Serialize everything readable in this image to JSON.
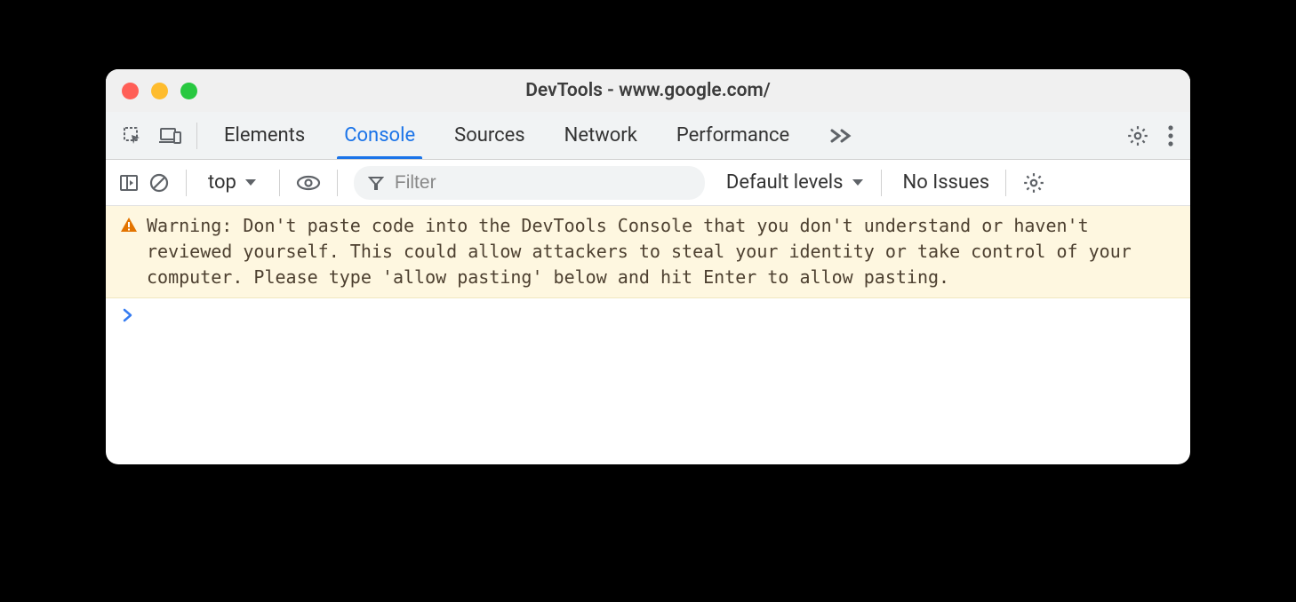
{
  "window": {
    "title": "DevTools - www.google.com/"
  },
  "tabs": {
    "items": [
      "Elements",
      "Console",
      "Sources",
      "Network",
      "Performance"
    ],
    "active_index": 1
  },
  "toolbar": {
    "context": "top",
    "filter_placeholder": "Filter",
    "levels": "Default levels",
    "issues": "No Issues"
  },
  "console": {
    "warning": "Warning: Don't paste code into the DevTools Console that you don't understand or haven't reviewed yourself. This could allow attackers to steal your identity or take control of your computer. Please type 'allow pasting' below and hit Enter to allow pasting."
  }
}
